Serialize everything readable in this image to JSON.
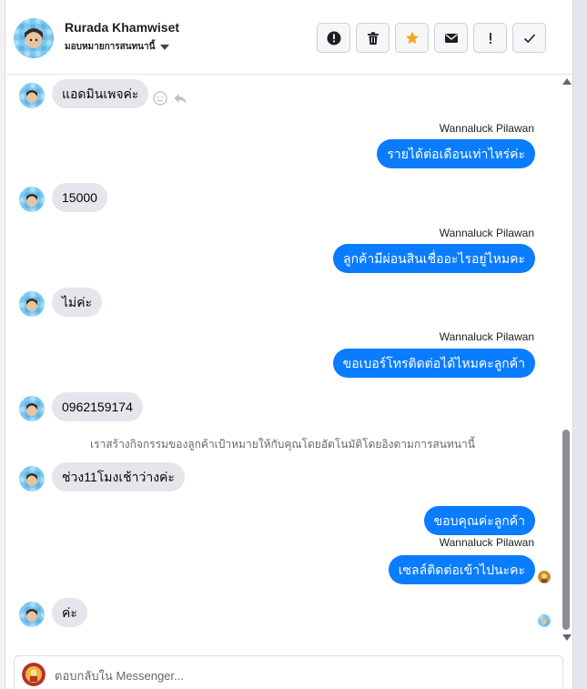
{
  "contact": {
    "name": "Rurada Khamwiset",
    "assign_label": "มอบหมายการสนทนานี้"
  },
  "actions": [
    {
      "name": "spam-button",
      "icon": "alert-circle-icon"
    },
    {
      "name": "delete-button",
      "icon": "trash-icon"
    },
    {
      "name": "star-button",
      "icon": "star-icon"
    },
    {
      "name": "unread-button",
      "icon": "envelope-icon"
    },
    {
      "name": "follow-up-button",
      "icon": "exclamation-icon"
    },
    {
      "name": "done-button",
      "icon": "check-icon"
    }
  ],
  "colors": {
    "outgoing": "#0a7cff",
    "incoming": "#e4e6eb",
    "star": "#f5a623"
  },
  "messages": {
    "m1": "แอดมินเพจค่ะ",
    "s1": "Wannaluck Pilawan",
    "o1": "รายได้ต่อเดือนเท่าไหร่ค่ะ",
    "m2": "15000",
    "s2": "Wannaluck Pilawan",
    "o2": "ลูกค้ามีผ่อนสินเชื่ออะไรอยู่ไหมคะ",
    "m3": "ไม่ค่ะ",
    "s3": "Wannaluck Pilawan",
    "o3": "ขอเบอร์โทรติดต่อได้ไหมคะลูกค้า",
    "m4": "0962159174",
    "system_note": "เราสร้างกิจกรรมของลูกค้าเป้าหมายให้กับคุณโดยอัตโนมัติโดยอิงตามการสนทนานี้",
    "m5": "ช่วง11โมงเช้าว่างค่ะ",
    "o4": "ขอบคุณค่ะลูกค้า",
    "s4": "Wannaluck Pilawan",
    "o5": "เซลล์ติดต่อเข้าไปนะคะ",
    "m6": "ค่ะ"
  },
  "composer": {
    "placeholder": "ตอบกลับใน Messenger..."
  }
}
